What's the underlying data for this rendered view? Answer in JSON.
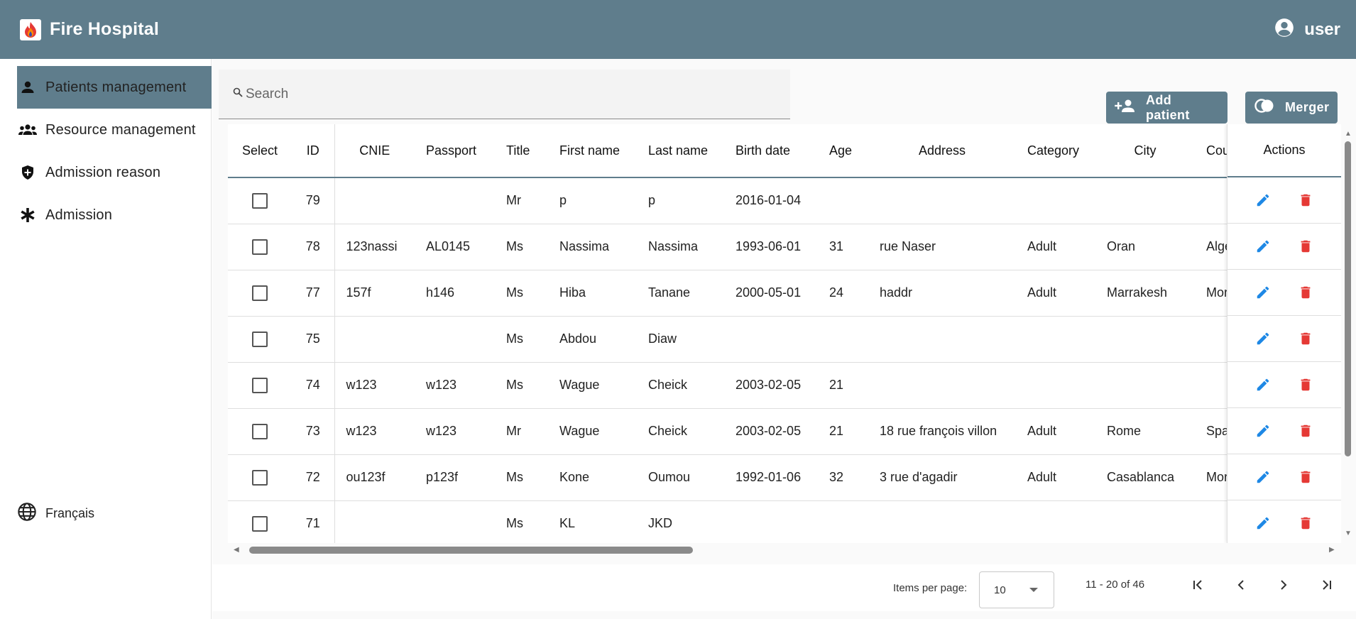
{
  "app": {
    "title": "Fire Hospital",
    "user": "user"
  },
  "sidebar": {
    "items": [
      {
        "label": "Patients management",
        "icon": "person-icon",
        "active": true
      },
      {
        "label": "Resource management",
        "icon": "group-icon",
        "active": false
      },
      {
        "label": "Admission reason",
        "icon": "shield-plus-icon",
        "active": false
      },
      {
        "label": "Admission",
        "icon": "asterisk-icon",
        "active": false
      }
    ],
    "language": "Français"
  },
  "search": {
    "placeholder": "Search",
    "value": ""
  },
  "toolbar": {
    "add_label": "Add patient",
    "merge_label": "Merger"
  },
  "table": {
    "columns": [
      "Select",
      "ID",
      "CNIE",
      "Passport",
      "Title",
      "First name",
      "Last name",
      "Birth date",
      "Age",
      "Address",
      "Category",
      "City",
      "Country",
      "Actions"
    ],
    "visible_headers": {
      "select": "Select",
      "id": "ID",
      "cnie": "CNIE",
      "passport": "Passport",
      "title": "Title",
      "first": "First name",
      "last": "Last name",
      "birth": "Birth date",
      "age": "Age",
      "address": "Address",
      "category": "Category",
      "city": "City",
      "country": "Cou",
      "actions": "Actions"
    },
    "rows": [
      {
        "id": "79",
        "cnie": "",
        "passport": "",
        "title": "Mr",
        "first": "p",
        "last": "p",
        "birth": "2016-01-04",
        "age": "",
        "address": "",
        "category": "",
        "city": "",
        "country": ""
      },
      {
        "id": "78",
        "cnie": "123nassi",
        "passport": "AL0145",
        "title": "Ms",
        "first": "Nassima",
        "last": "Nassima",
        "birth": "1993-06-01",
        "age": "31",
        "address": "rue Naser",
        "category": "Adult",
        "city": "Oran",
        "country": "Alge"
      },
      {
        "id": "77",
        "cnie": "157f",
        "passport": "h146",
        "title": "Ms",
        "first": "Hiba",
        "last": "Tanane",
        "birth": "2000-05-01",
        "age": "24",
        "address": "haddr",
        "category": "Adult",
        "city": "Marrakesh",
        "country": "Mor"
      },
      {
        "id": "75",
        "cnie": "",
        "passport": "",
        "title": "Ms",
        "first": "Abdou",
        "last": "Diaw",
        "birth": "",
        "age": "",
        "address": "",
        "category": "",
        "city": "",
        "country": ""
      },
      {
        "id": "74",
        "cnie": "w123",
        "passport": "w123",
        "title": "Ms",
        "first": "Wague",
        "last": "Cheick",
        "birth": "2003-02-05",
        "age": "21",
        "address": "",
        "category": "",
        "city": "",
        "country": ""
      },
      {
        "id": "73",
        "cnie": "w123",
        "passport": "w123",
        "title": "Mr",
        "first": "Wague",
        "last": "Cheick",
        "birth": "2003-02-05",
        "age": "21",
        "address": "18 rue françois villon",
        "category": "Adult",
        "city": "Rome",
        "country": "Spa"
      },
      {
        "id": "72",
        "cnie": "ou123f",
        "passport": "p123f",
        "title": "Ms",
        "first": "Kone",
        "last": "Oumou",
        "birth": "1992-01-06",
        "age": "32",
        "address": "3 rue d'agadir",
        "category": "Adult",
        "city": "Casablanca",
        "country": "Mor"
      },
      {
        "id": "71",
        "cnie": "",
        "passport": "",
        "title": "Ms",
        "first": "KL",
        "last": "JKD",
        "birth": "",
        "age": "",
        "address": "",
        "category": "",
        "city": "",
        "country": ""
      }
    ]
  },
  "paginator": {
    "items_label": "Items per page:",
    "page_size": "10",
    "range": "11 - 20 of 46"
  },
  "colors": {
    "primary": "#5f7d8c",
    "edit": "#1e88e5",
    "delete": "#e53935"
  }
}
